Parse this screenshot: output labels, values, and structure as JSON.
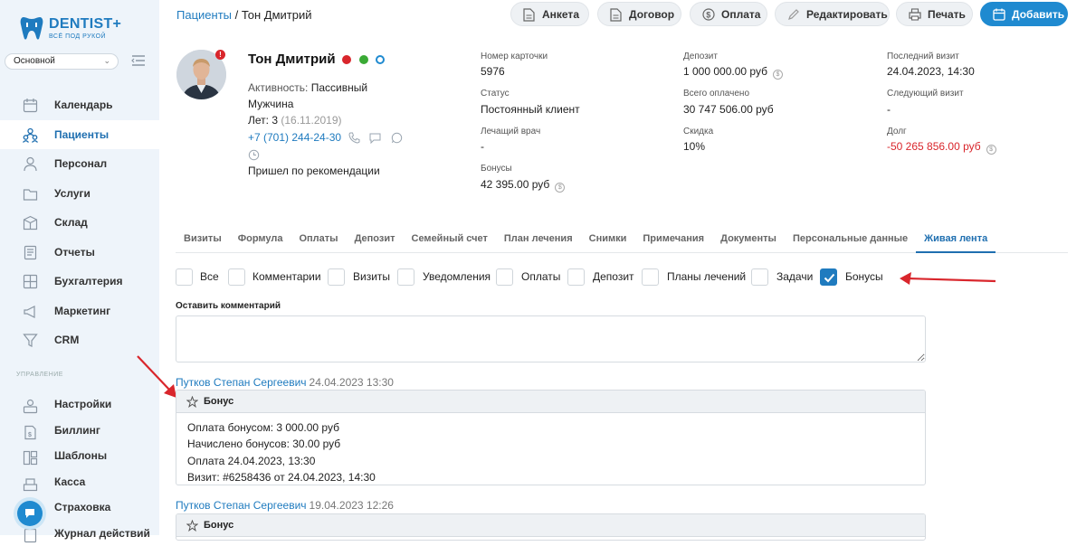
{
  "brand": {
    "name": "DENTIST",
    "plus": "+",
    "tagline": "ВСЁ ПОД РУКОЙ"
  },
  "branch": {
    "selected": "Основной"
  },
  "sidebar": {
    "items": [
      {
        "label": "Календарь",
        "icon": "calendar-icon"
      },
      {
        "label": "Пациенты",
        "icon": "patients-icon",
        "active": true
      },
      {
        "label": "Персонал",
        "icon": "staff-icon"
      },
      {
        "label": "Услуги",
        "icon": "services-icon"
      },
      {
        "label": "Склад",
        "icon": "warehouse-icon"
      },
      {
        "label": "Отчеты",
        "icon": "reports-icon"
      },
      {
        "label": "Бухгалтерия",
        "icon": "accounting-icon"
      },
      {
        "label": "Маркетинг",
        "icon": "marketing-icon"
      },
      {
        "label": "CRM",
        "icon": "crm-icon"
      }
    ],
    "section_label": "УПРАВЛЕНИЕ",
    "admin_items": [
      {
        "label": "Настройки",
        "icon": "settings-icon"
      },
      {
        "label": "Биллинг",
        "icon": "billing-icon"
      },
      {
        "label": "Шаблоны",
        "icon": "templates-icon"
      },
      {
        "label": "Касса",
        "icon": "cashbox-icon"
      },
      {
        "label": "Страховка",
        "icon": "insurance-icon"
      },
      {
        "label": "Журнал действий",
        "icon": "log-icon"
      }
    ]
  },
  "breadcrumb": {
    "parent": "Пациенты",
    "separator": " / ",
    "current": "Тон Дмитрий"
  },
  "toolbar": {
    "form": "Анкета",
    "contract": "Договор",
    "payment": "Оплата",
    "edit": "Редактировать",
    "print": "Печать",
    "add": "Добавить"
  },
  "patient": {
    "name": "Тон Дмитрий",
    "status_dots": [
      "#d9262c",
      "#3aaa35",
      "#1f8ad0"
    ],
    "activity_label": "Активность:",
    "activity": "Пассивный",
    "gender": "Мужчина",
    "age_label": "Лет:",
    "age": "3",
    "birth_date": "(16.11.2019)",
    "phone": "+7 (701) 244-24-30",
    "source": "Пришел по рекомендации"
  },
  "info": {
    "card_number": {
      "label": "Номер карточки",
      "value": "5976"
    },
    "status": {
      "label": "Статус",
      "value": "Постоянный клиент"
    },
    "doctor": {
      "label": "Лечащий врач",
      "value": "-"
    },
    "bonuses": {
      "label": "Бонусы",
      "value": "42 395.00 руб"
    },
    "deposit": {
      "label": "Депозит",
      "value": "1 000 000.00 руб"
    },
    "total_paid": {
      "label": "Всего оплачено",
      "value": "30 747 506.00 руб"
    },
    "discount": {
      "label": "Скидка",
      "value": "10%"
    },
    "last_visit": {
      "label": "Последний визит",
      "value": "24.04.2023, 14:30"
    },
    "next_visit": {
      "label": "Следующий визит",
      "value": "-"
    },
    "debt": {
      "label": "Долг",
      "value": "-50 265 856.00 руб"
    }
  },
  "tabs": [
    "Визиты",
    "Формула",
    "Оплаты",
    "Депозит",
    "Семейный счет",
    "План лечения",
    "Снимки",
    "Примечания",
    "Документы",
    "Персональные данные",
    "Живая лента"
  ],
  "active_tab": "Живая лента",
  "filters": [
    {
      "label": "Все",
      "checked": false
    },
    {
      "label": "Комментарии",
      "checked": false
    },
    {
      "label": "Визиты",
      "checked": false
    },
    {
      "label": "Уведомления",
      "checked": false
    },
    {
      "label": "Оплаты",
      "checked": false
    },
    {
      "label": "Депозит",
      "checked": false
    },
    {
      "label": "Планы лечений",
      "checked": false
    },
    {
      "label": "Задачи",
      "checked": false
    },
    {
      "label": "Бонусы",
      "checked": true
    }
  ],
  "comment": {
    "label": "Оставить комментарий",
    "value": ""
  },
  "feed": [
    {
      "author": "Путков Степан Сергеевич",
      "time": "24.04.2023 13:30",
      "title": "Бонус",
      "lines": [
        "Оплата бонусом: 3 000.00 руб",
        "Начислено бонусов: 30.00 руб",
        "Оплата 24.04.2023, 13:30",
        "Визит: #6258436 от 24.04.2023, 14:30"
      ]
    },
    {
      "author": "Путков Степан Сергеевич",
      "time": "19.04.2023 12:26",
      "title": "Бонус",
      "lines": []
    }
  ],
  "colors": {
    "accent": "#1f7bbf",
    "primary_button": "#1f8ad0",
    "danger": "#d9262c",
    "sidebar_bg": "#eef4fa",
    "annotation_arrow": "#d9262c"
  }
}
